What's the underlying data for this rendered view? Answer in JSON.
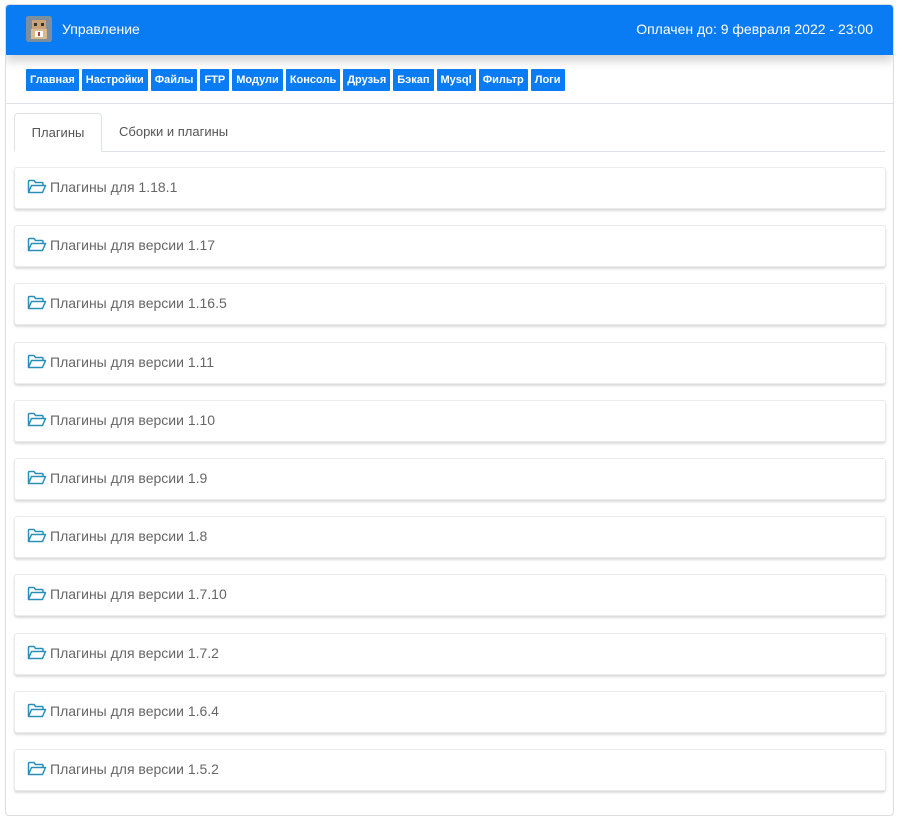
{
  "header": {
    "title": "Управление",
    "paid_until": "Оплачен до: 9 февраля 2022 - 23:00",
    "avatar_icon": "user-avatar-icon",
    "accent_color": "#0a7cf3"
  },
  "nav": {
    "items": [
      {
        "label": "Главная"
      },
      {
        "label": "Настройки"
      },
      {
        "label": "Файлы"
      },
      {
        "label": "FTP"
      },
      {
        "label": "Модули"
      },
      {
        "label": "Консоль"
      },
      {
        "label": "Друзья"
      },
      {
        "label": "Бэкап"
      },
      {
        "label": "Mysql"
      },
      {
        "label": "Фильтр"
      },
      {
        "label": "Логи"
      }
    ]
  },
  "tabs": [
    {
      "label": "Плагины",
      "active": true
    },
    {
      "label": "Сборки и плагины",
      "active": false
    }
  ],
  "folders": {
    "icon": "folder-open-icon",
    "icon_color": "#2a8fb8",
    "items": [
      {
        "label": "Плагины для 1.18.1"
      },
      {
        "label": "Плагины для версии 1.17"
      },
      {
        "label": "Плагины для версии 1.16.5"
      },
      {
        "label": "Плагины для версии 1.11"
      },
      {
        "label": "Плагины для версии 1.10"
      },
      {
        "label": "Плагины для версии 1.9"
      },
      {
        "label": "Плагины для версии 1.8"
      },
      {
        "label": "Плагины для версии 1.7.10"
      },
      {
        "label": "Плагины для версии 1.7.2"
      },
      {
        "label": "Плагины для версии 1.6.4"
      },
      {
        "label": "Плагины для версии 1.5.2"
      }
    ]
  }
}
